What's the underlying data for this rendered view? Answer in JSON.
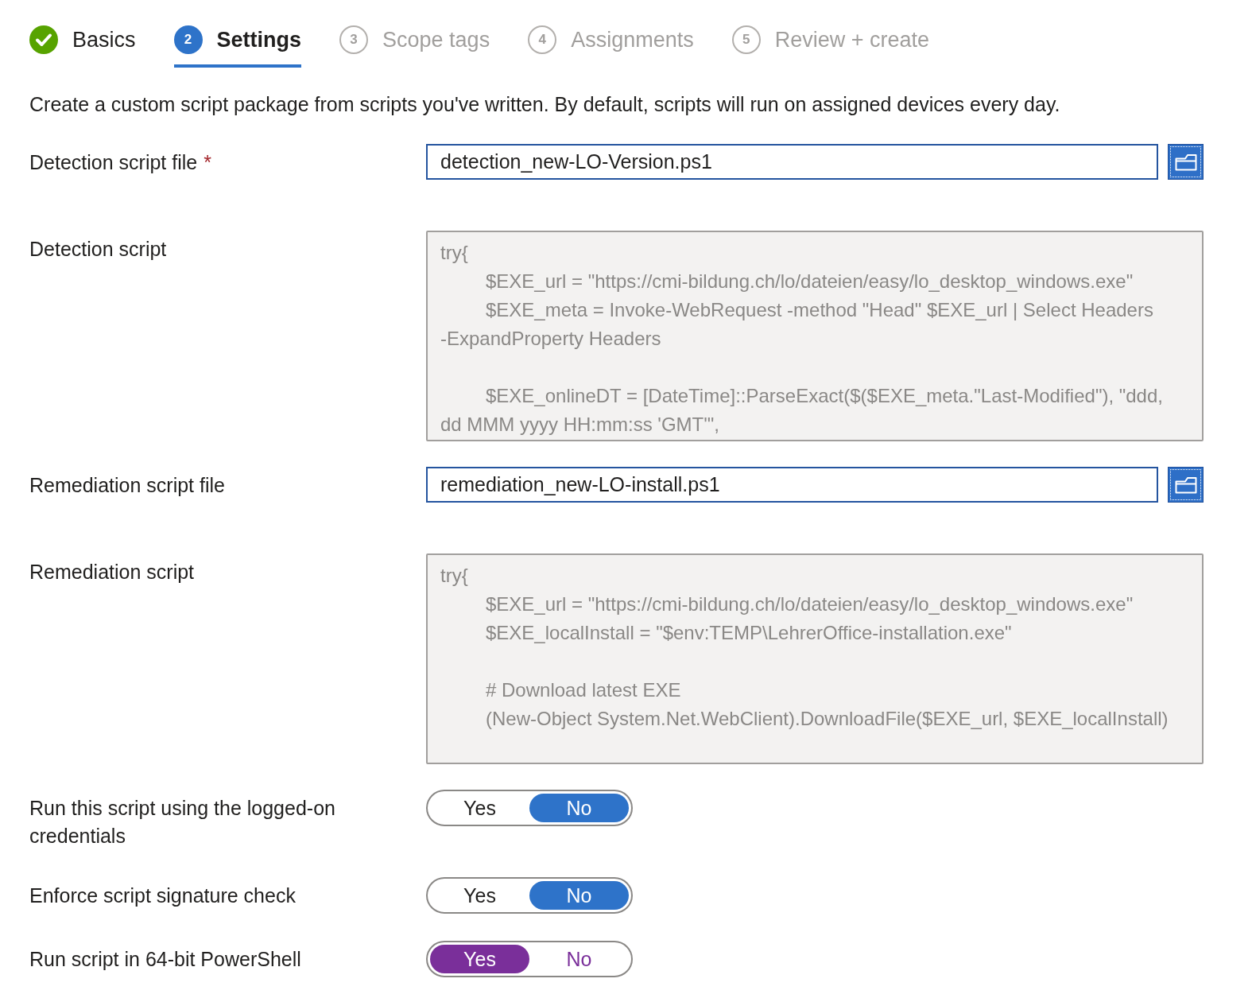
{
  "steps": [
    {
      "label": "Basics",
      "completed": true,
      "selected": false
    },
    {
      "number": "2",
      "label": "Settings",
      "completed": false,
      "selected": true
    },
    {
      "number": "3",
      "label": "Scope tags",
      "completed": false,
      "selected": false
    },
    {
      "number": "4",
      "label": "Assignments",
      "completed": false,
      "selected": false
    },
    {
      "number": "5",
      "label": "Review + create",
      "completed": false,
      "selected": false
    }
  ],
  "description": "Create a custom script package from scripts you've written. By default, scripts will run on assigned devices every day.",
  "fields": [
    {
      "kind": "file",
      "label": "Detection script file",
      "required_mark": "*",
      "value": "detection_new-LO-Version.ps1"
    },
    {
      "kind": "script",
      "label": "Detection script",
      "value": "try{\n\t$EXE_url = \"https://cmi-bildung.ch/lo/dateien/easy/lo_desktop_windows.exe\"\n\t$EXE_meta = Invoke-WebRequest -method \"Head\" $EXE_url | Select Headers\n-ExpandProperty Headers\n\n\t$EXE_onlineDT = [DateTime]::ParseExact($($EXE_meta.\"Last-Modified\"), \"ddd,\ndd MMM yyyy HH:mm:ss 'GMT'\","
    },
    {
      "kind": "file",
      "label": "Remediation script file",
      "value": "remediation_new-LO-install.ps1"
    },
    {
      "kind": "script",
      "label": "Remediation script",
      "value": "try{\n\t$EXE_url = \"https://cmi-bildung.ch/lo/dateien/easy/lo_desktop_windows.exe\"\n\t$EXE_localInstall = \"$env:TEMP\\LehrerOffice-installation.exe\"\n\n\t# Download latest EXE\n\t(New-Object System.Net.WebClient).DownloadFile($EXE_url, $EXE_localInstall)"
    },
    {
      "kind": "toggle",
      "label": "Run this script using the logged-on credentials",
      "modified": false,
      "options": [
        {
          "label": "Yes",
          "selected": false
        },
        {
          "label": "No",
          "selected": true
        }
      ]
    },
    {
      "kind": "toggle",
      "label": "Enforce script signature check",
      "modified": false,
      "options": [
        {
          "label": "Yes",
          "selected": false
        },
        {
          "label": "No",
          "selected": true
        }
      ]
    },
    {
      "kind": "toggle",
      "label": "Run script in 64-bit PowerShell",
      "modified": true,
      "options": [
        {
          "label": "Yes",
          "selected": true
        },
        {
          "label": "No",
          "selected": false
        }
      ]
    }
  ]
}
